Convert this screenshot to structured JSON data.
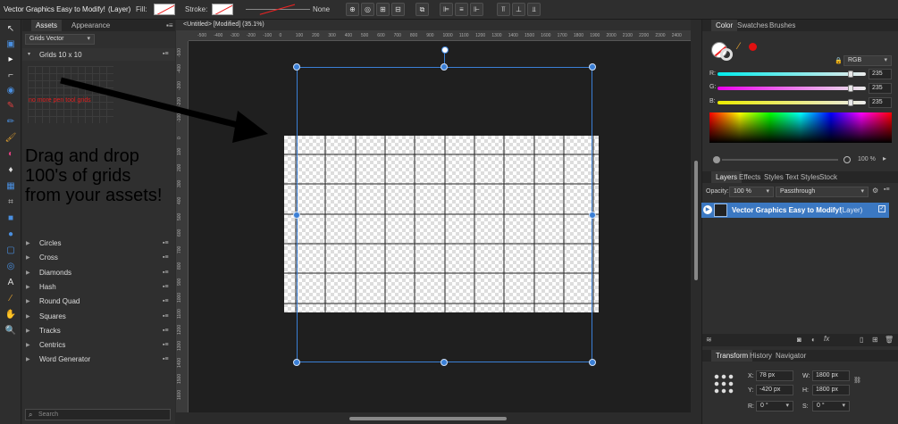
{
  "toolbar": {
    "context_title": "Vector Graphics Easy to Modify!",
    "context_kind": "(Layer)",
    "fill_label": "Fill:",
    "stroke_label": "Stroke:",
    "stroke_style_value": "None"
  },
  "assets": {
    "tabs": [
      "Assets",
      "Appearance"
    ],
    "category_select": "Grids Vector",
    "group_title": "Grids 10 x 10",
    "note_red": "no more pen tool grids",
    "promo_line1": "Drag and drop",
    "promo_line2": "100's of grids",
    "promo_line3": "from your assets!",
    "categories": [
      "Circles",
      "Cross",
      "Diamonds",
      "Hash",
      "Round Quad",
      "Squares",
      "Tracks",
      "Centrics",
      "Word Generator"
    ],
    "search_placeholder": "Search"
  },
  "document": {
    "title": "<Untitled> [Modified] (35.1%)",
    "hruler_labels": [
      "-500",
      "-400",
      "-300",
      "-200",
      "-100",
      "0",
      "100",
      "200",
      "300",
      "400",
      "500",
      "600",
      "700",
      "800",
      "900",
      "1000",
      "1100",
      "1200",
      "1300",
      "1400",
      "1500",
      "1600",
      "1700",
      "1800",
      "1900",
      "2000",
      "2100",
      "2200",
      "2300",
      "2400"
    ],
    "vruler_labels": [
      "-500",
      "-400",
      "-300",
      "-200",
      "-100",
      "0",
      "100",
      "200",
      "300",
      "400",
      "500",
      "600",
      "700",
      "800",
      "900",
      "1000",
      "1100",
      "1200",
      "1300",
      "1400",
      "1500",
      "1600"
    ]
  },
  "color_panel": {
    "tabs": [
      "Color",
      "Swatches",
      "Brushes"
    ],
    "model": "RGB",
    "r_label": "R:",
    "g_label": "G:",
    "b_label": "B:",
    "r_value": "235",
    "g_value": "235",
    "b_value": "235",
    "opacity_value": "100 %"
  },
  "layers_panel": {
    "tabs": [
      "Layers",
      "Effects",
      "Styles",
      "Text Styles",
      "Stock"
    ],
    "opacity_label": "Opacity:",
    "opacity_value": "100 %",
    "blend_mode": "Passthrough",
    "layer_name": "Vector Graphics Easy to Modify!",
    "layer_kind": "(Layer)"
  },
  "transform_panel": {
    "tabs": [
      "Transform",
      "History",
      "Navigator"
    ],
    "x_label": "X:",
    "x_value": "78 px",
    "y_label": "Y:",
    "y_value": "-420 px",
    "w_label": "W:",
    "w_value": "1800 px",
    "h_label": "H:",
    "h_value": "1800 px",
    "r_label": "R:",
    "r_value": "0 °",
    "s_label": "S:",
    "s_value": "0 °"
  },
  "colors": {
    "accent": "#3b78c2",
    "promo_text": "#000000",
    "note_text": "#e02020",
    "canvas_bg": "#1f1f1f"
  }
}
